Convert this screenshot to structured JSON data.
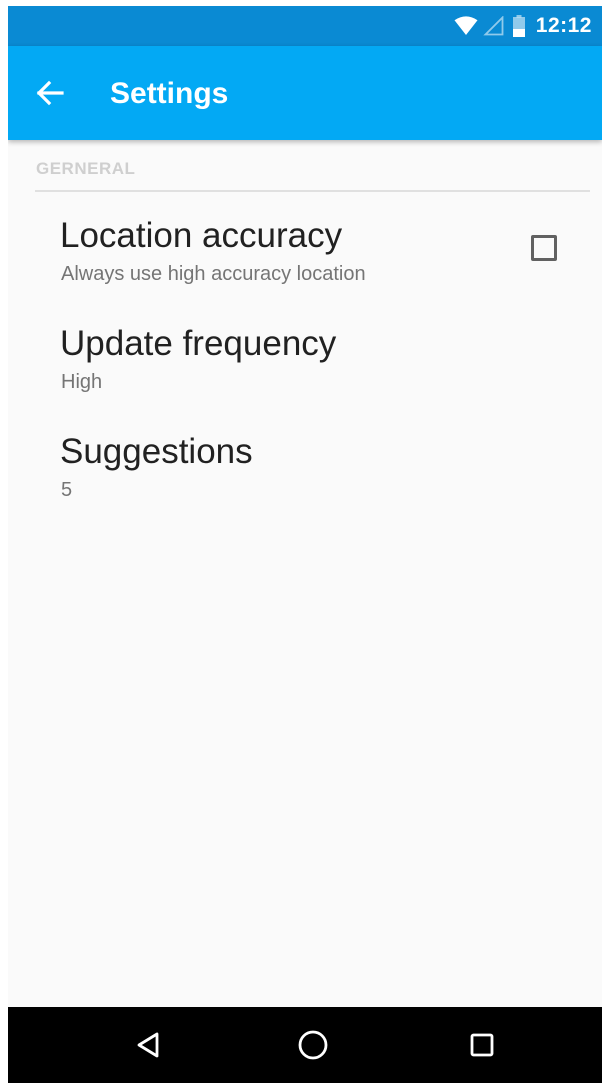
{
  "status_bar": {
    "time": "12:12",
    "icons": [
      "wifi-icon",
      "cellular-signal-icon",
      "battery-icon"
    ]
  },
  "app_bar": {
    "back_icon": "arrow-back-icon",
    "title": "Settings",
    "color": "#03a9f4"
  },
  "section": {
    "header": "GERNERAL"
  },
  "preferences": [
    {
      "title": "Location accuracy",
      "summary": "Always use high accuracy location",
      "checkbox": true,
      "checked": false
    },
    {
      "title": "Update frequency",
      "summary": "High"
    },
    {
      "title": "Suggestions",
      "summary": "5"
    }
  ],
  "nav_bar": {
    "icons": [
      "back-triangle-icon",
      "home-circle-icon",
      "recents-square-icon"
    ]
  }
}
